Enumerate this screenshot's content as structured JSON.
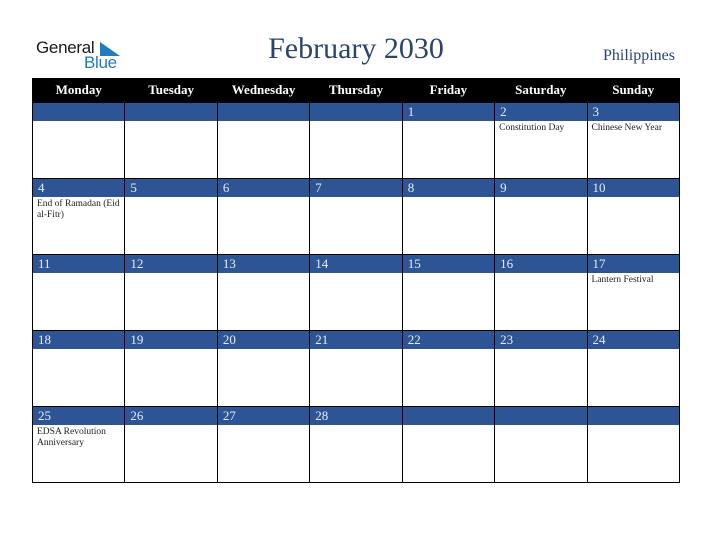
{
  "logo": {
    "word1": "General",
    "word2": "Blue",
    "icon": "triangle-flag-icon",
    "accent": "#1f7bc2"
  },
  "title": "February 2030",
  "country": "Philippines",
  "colors": {
    "header_bg": "#000000",
    "daybar_bg": "#2d5595",
    "title": "#2a4470"
  },
  "weekdays": [
    "Monday",
    "Tuesday",
    "Wednesday",
    "Thursday",
    "Friday",
    "Saturday",
    "Sunday"
  ],
  "weeks": [
    [
      {
        "day": "",
        "event": ""
      },
      {
        "day": "",
        "event": ""
      },
      {
        "day": "",
        "event": ""
      },
      {
        "day": "",
        "event": ""
      },
      {
        "day": "1",
        "event": ""
      },
      {
        "day": "2",
        "event": "Constitution Day"
      },
      {
        "day": "3",
        "event": "Chinese New Year"
      }
    ],
    [
      {
        "day": "4",
        "event": "End of Ramadan (Eid al-Fitr)"
      },
      {
        "day": "5",
        "event": ""
      },
      {
        "day": "6",
        "event": ""
      },
      {
        "day": "7",
        "event": ""
      },
      {
        "day": "8",
        "event": ""
      },
      {
        "day": "9",
        "event": ""
      },
      {
        "day": "10",
        "event": ""
      }
    ],
    [
      {
        "day": "11",
        "event": ""
      },
      {
        "day": "12",
        "event": ""
      },
      {
        "day": "13",
        "event": ""
      },
      {
        "day": "14",
        "event": ""
      },
      {
        "day": "15",
        "event": ""
      },
      {
        "day": "16",
        "event": ""
      },
      {
        "day": "17",
        "event": "Lantern Festival"
      }
    ],
    [
      {
        "day": "18",
        "event": ""
      },
      {
        "day": "19",
        "event": ""
      },
      {
        "day": "20",
        "event": ""
      },
      {
        "day": "21",
        "event": ""
      },
      {
        "day": "22",
        "event": ""
      },
      {
        "day": "23",
        "event": ""
      },
      {
        "day": "24",
        "event": ""
      }
    ],
    [
      {
        "day": "25",
        "event": "EDSA Revolution Anniversary"
      },
      {
        "day": "26",
        "event": ""
      },
      {
        "day": "27",
        "event": ""
      },
      {
        "day": "28",
        "event": ""
      },
      {
        "day": "",
        "event": ""
      },
      {
        "day": "",
        "event": ""
      },
      {
        "day": "",
        "event": ""
      }
    ]
  ]
}
